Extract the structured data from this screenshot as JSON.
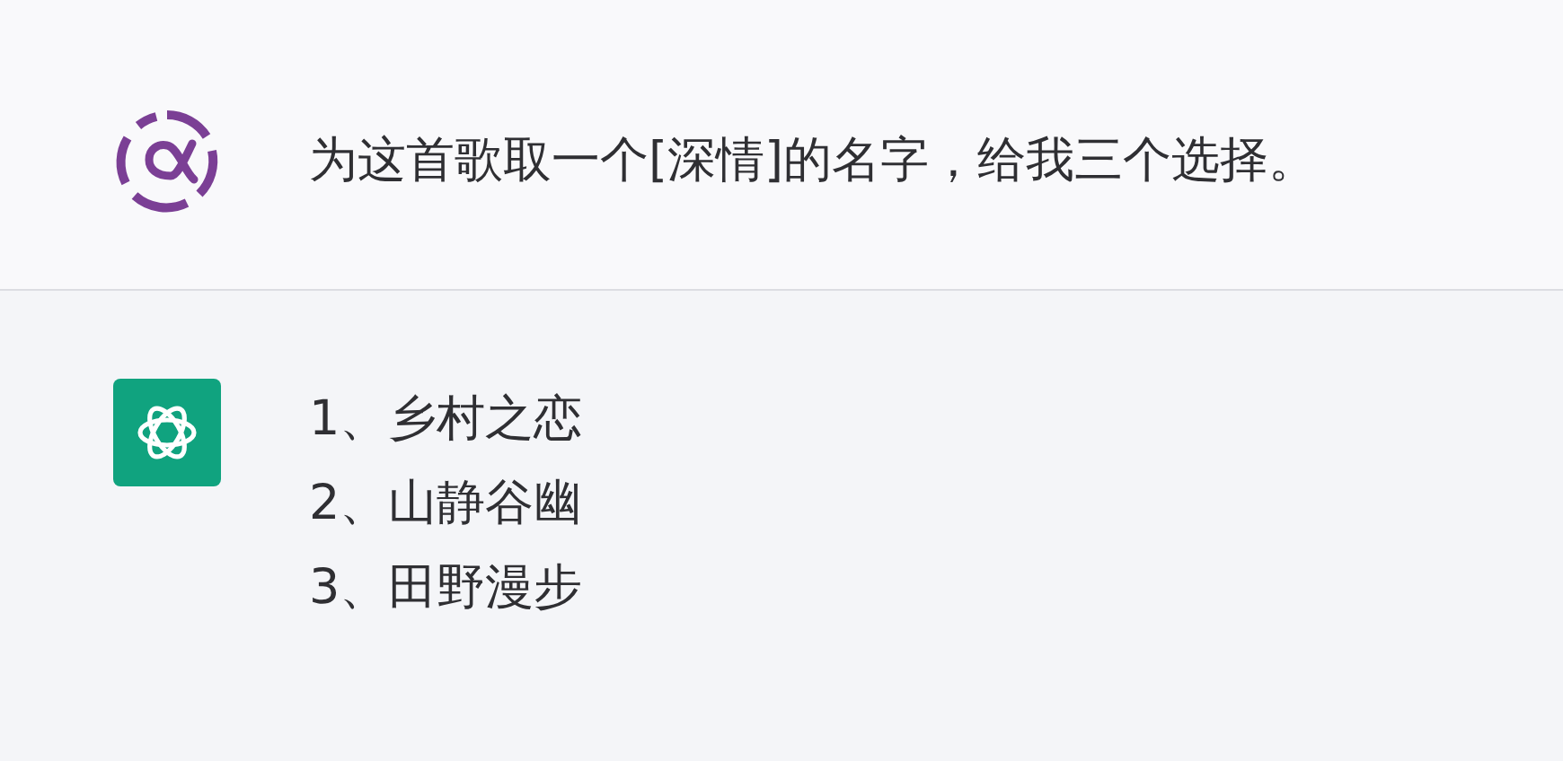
{
  "messages": [
    {
      "kind": "user",
      "lines": [
        "为这首歌取一个[深情]的名字，给我三个选择。"
      ]
    },
    {
      "kind": "assistant",
      "lines": [
        "1、乡村之恋",
        "2、山静谷幽",
        "3、田野漫步"
      ]
    }
  ]
}
